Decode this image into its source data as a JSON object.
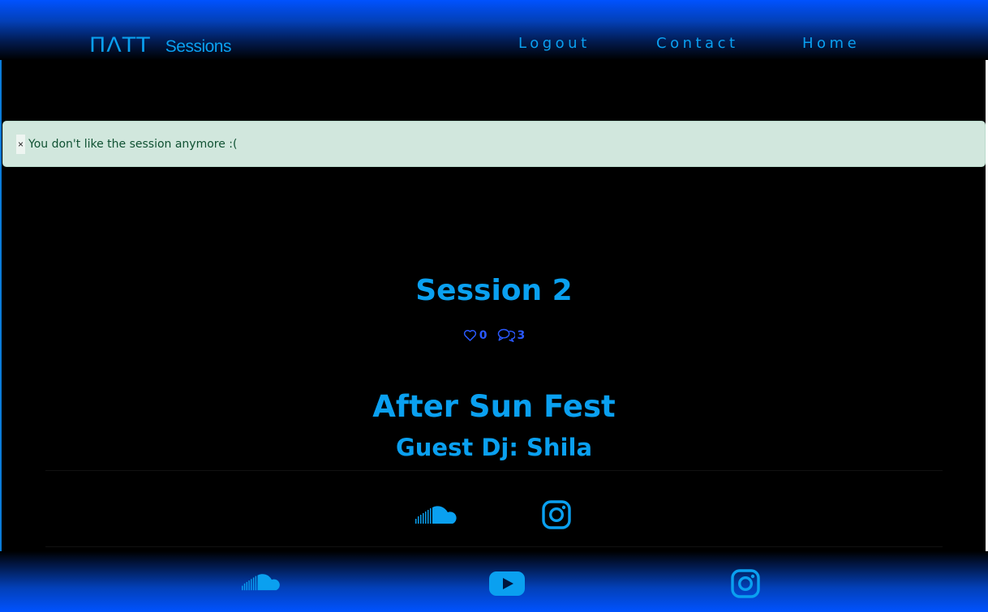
{
  "header": {
    "logo_text": "ΠΛΤΤ",
    "brand_name": "Sessions",
    "nav": {
      "logout": "Logout",
      "contact": "Contact",
      "home": "Home"
    }
  },
  "alert": {
    "close_label": "×",
    "message": "You don't like the session anymore :("
  },
  "session": {
    "title": "Session 2",
    "likes": "0",
    "comments": "3",
    "event": "After Sun Fest",
    "guest_dj": "Guest Dj: Shila",
    "dj_links": [
      "soundcloud-icon",
      "instagram-icon"
    ]
  },
  "footer": {
    "links": [
      "soundcloud-icon",
      "youtube-icon",
      "instagram-icon"
    ]
  },
  "colors": {
    "accent": "#0aa0f0",
    "stat_blue": "#2a59ff",
    "header_blue": "#0052ff",
    "alert_bg": "#d1e7dd",
    "alert_text": "#0f5132"
  }
}
